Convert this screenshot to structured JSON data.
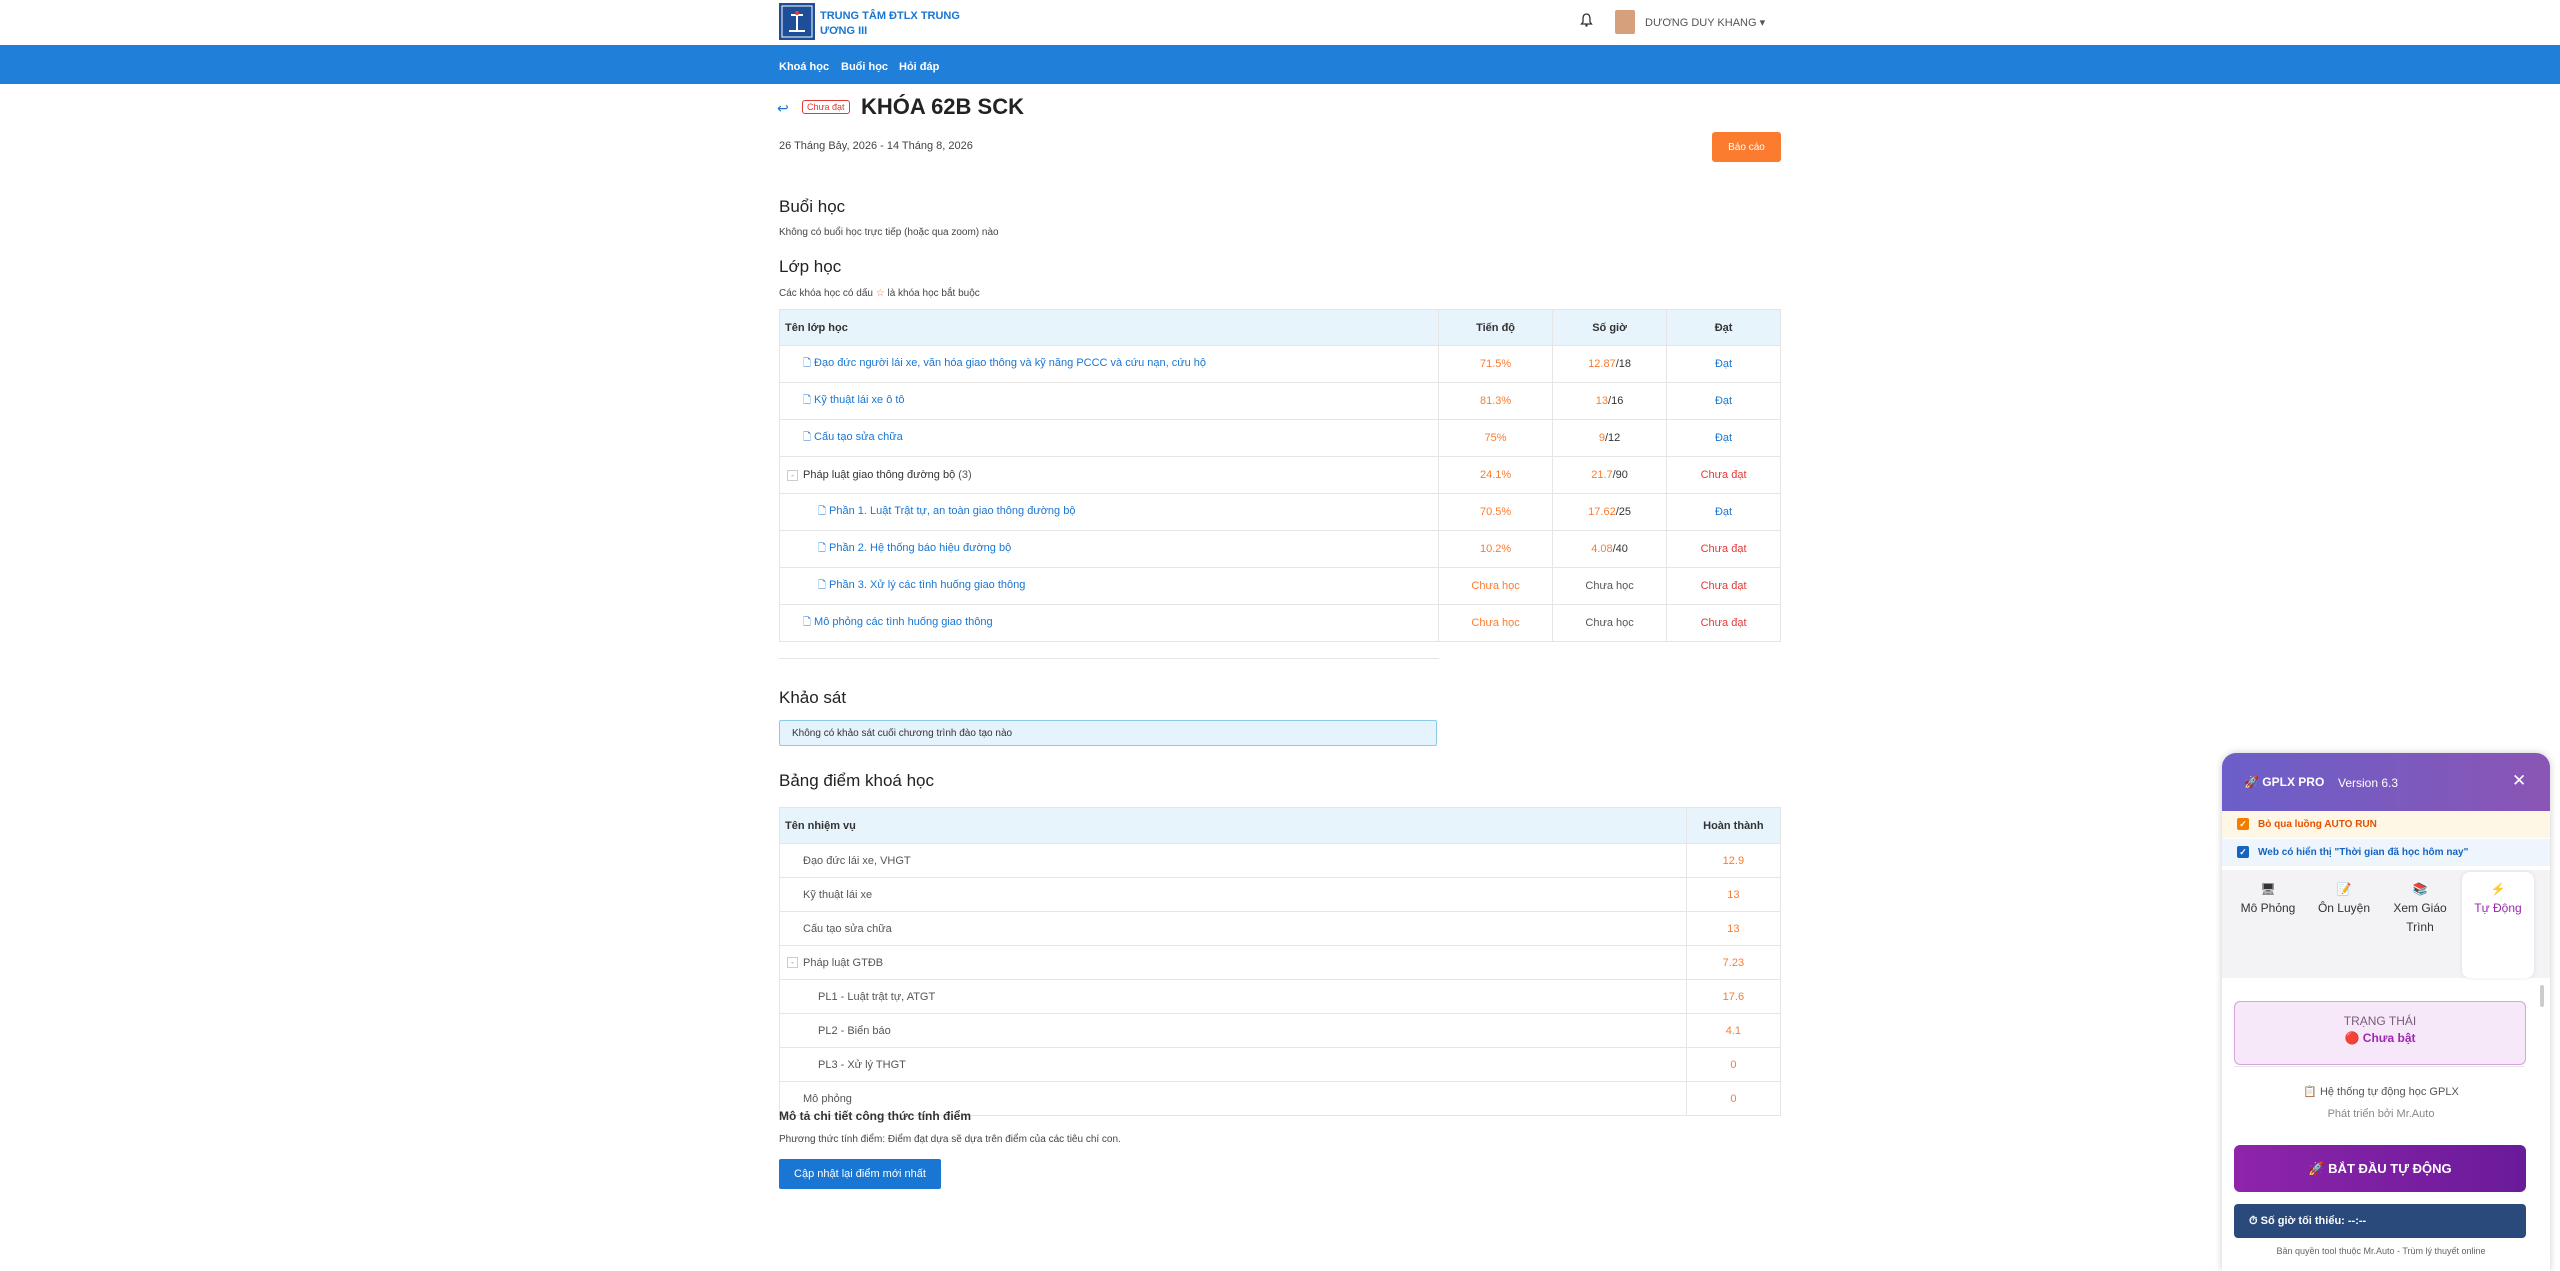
{
  "header": {
    "org_name": "TRUNG TÂM ĐTLX TRUNG ƯƠNG III",
    "bell_icon": "bell-icon",
    "user_name": "DƯƠNG DUY KHANG ▾"
  },
  "nav": {
    "items": [
      "Khoá học",
      "Buổi học",
      "Hỏi đáp"
    ]
  },
  "course": {
    "back_icon": "↩",
    "status_badge": "Chưa đạt",
    "title": "KHÓA 62B SCK",
    "dates": "26 Tháng Bảy, 2026 - 14 Tháng 8, 2026",
    "report_button": "Báo cáo"
  },
  "sessions": {
    "heading": "Buổi học",
    "empty_text": "Không có buổi học trực tiếp (hoặc qua zoom) nào"
  },
  "classes": {
    "heading": "Lớp học",
    "note_before": "Các khóa học có dấu ",
    "note_star": "☆",
    "note_after": " là khóa học bắt buộc",
    "columns": [
      "Tên lớp học",
      "Tiến độ",
      "Số giờ",
      "Đạt"
    ],
    "rows": [
      {
        "name": "Đạo đức người lái xe, văn hóa giao thông và kỹ năng PCCC và cứu nạn, cứu hộ",
        "progress": "71.5%",
        "hours_done": "12.87",
        "hours_total": "/18",
        "result": "Đạt"
      },
      {
        "name": "Kỹ thuật lái xe ô tô",
        "progress": "81.3%",
        "hours_done": "13",
        "hours_total": "/16",
        "result": "Đạt"
      },
      {
        "name": "Cấu tạo sửa chữa",
        "progress": "75%",
        "hours_done": "9",
        "hours_total": "/12",
        "result": "Đạt"
      },
      {
        "name": "Pháp luật giao thông đường bộ",
        "count": "(3)",
        "progress": "24.1%",
        "hours_done": "21.7",
        "hours_total": "/90",
        "result": "Chưa đạt"
      },
      {
        "name": "Phần 1. Luật Trật tự, an toàn giao thông đường bộ",
        "progress": "70.5%",
        "hours_done": "17.62",
        "hours_total": "/25",
        "result": "Đạt"
      },
      {
        "name": "Phần 2. Hệ thống báo hiệu đường bộ",
        "progress": "10.2%",
        "hours_done": "4.08",
        "hours_total": "/40",
        "result": "Chưa đạt"
      },
      {
        "name": "Phần 3. Xử lý các tình huống giao thông",
        "progress": "Chưa học",
        "hours_text": "Chưa học",
        "result": "Chưa đạt"
      },
      {
        "name": "Mô phỏng các tình huống giao thông",
        "progress": "Chưa học",
        "hours_text": "Chưa học",
        "result": "Chưa đạt"
      }
    ]
  },
  "survey": {
    "heading": "Khảo sát",
    "empty_text": "Không có khảo sát cuối chương trình đào tạo nào"
  },
  "scores": {
    "heading": "Bảng điểm khoá học",
    "columns": [
      "Tên nhiệm vụ",
      "Hoàn thành"
    ],
    "rows": [
      {
        "name": "Đạo đức lái xe, VHGT",
        "value": "12.9"
      },
      {
        "name": "Kỹ thuật lái xe",
        "value": "13"
      },
      {
        "name": "Cấu tạo sửa chữa",
        "value": "13"
      },
      {
        "name": "Pháp luật GTĐB",
        "value": "7.23"
      },
      {
        "name": "PL1 - Luật trật tự, ATGT",
        "value": "17.6"
      },
      {
        "name": "PL2 - Biển báo",
        "value": "4.1"
      },
      {
        "name": "PL3 - Xử lý THGT",
        "value": "0"
      },
      {
        "name": "Mô phỏng",
        "value": "0"
      }
    ],
    "formula_heading": "Mô tả chi tiết công thức tính điểm",
    "formula_text": "Phương thức tính điểm: Điểm đạt dựa sẽ dựa trên điểm của các tiêu chí con.",
    "update_button": "Cập nhật lại điểm mới nhất"
  },
  "gplx": {
    "title": "🚀 GPLX PRO",
    "version": "Version 6.3",
    "close": "✕",
    "check1": "Bỏ qua luồng AUTO RUN",
    "check2": "Web có hiển thị \"Thời gian đã học hôm nay\"",
    "tabs": [
      {
        "icon": "🖥",
        "label": "Mô Phỏng"
      },
      {
        "icon": "📝",
        "label": "Ôn Luyện"
      },
      {
        "icon": "📚",
        "label": "Xem Giáo Trình"
      },
      {
        "icon": "⚡",
        "label": "Tự Động"
      }
    ],
    "status_label": "TRẠNG THÁI",
    "status_value": "🔴 Chưa bật",
    "auto_title": "📋 Hệ thống tự động học GPLX",
    "auto_sub": "Phát triển bởi Mr.Auto",
    "start_button": "🚀 BẮT ĐẦU TỰ ĐỘNG",
    "min_hours": "⏱ Số giờ tối thiểu: --:--",
    "copyright": "Bản quyền tool thuộc Mr.Auto - Trùm lý thuyết online"
  }
}
